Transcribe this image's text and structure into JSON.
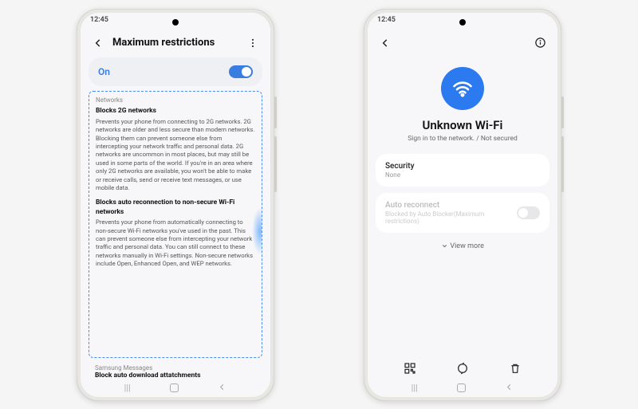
{
  "left": {
    "status_time": "12:45",
    "title": "Maximum restrictions",
    "toggle_label": "On",
    "section_label": "Networks",
    "item1_title": "Blocks 2G networks",
    "item1_body": "Prevents your phone from connecting to 2G networks. 2G networks are older and less secure than modern networks. Blocking them can prevent someone else from intercepting your network traffic and personal data. 2G networks are uncommon in most places, but may still be used in some parts of the world. If you're in an area where only 2G networks are available, you won't be able to make or receive calls, send or receive text messages, or use mobile data.",
    "item2_title": "Blocks auto reconnection to non-secure Wi-Fi networks",
    "item2_body": "Prevents your phone from automatically connecting to non-secure Wi-Fi networks you've used in the past. This can prevent someone else from intercepting your network traffic and personal data. You can still connect to these networks manually in Wi-Fi settings. Non-secure networks include Open, Enhanced Open, and WEP networks.",
    "below_section": "Samsung Messages",
    "below_item": "Block auto download attatchments"
  },
  "right": {
    "status_time": "12:45",
    "wifi_title": "Unknown Wi-Fi",
    "wifi_sub": "Sign in to the network. / Not secured",
    "security_label": "Security",
    "security_value": "None",
    "auto_label": "Auto reconnect",
    "auto_sub": "Blocked by Auto Blocker(Maximum restrictions)",
    "view_more": "View more"
  }
}
